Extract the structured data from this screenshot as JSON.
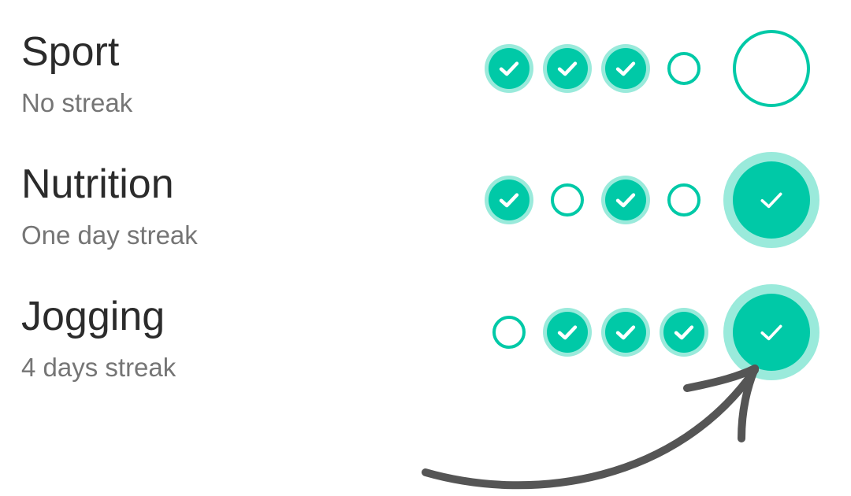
{
  "accent_color": "#00c9a7",
  "accent_halo_color": "#9aeadb",
  "arrow_color": "#555555",
  "habits": [
    {
      "name": "Sport",
      "streak": "No streak",
      "days": [
        true,
        true,
        true,
        false
      ],
      "today": false
    },
    {
      "name": "Nutrition",
      "streak": "One day streak",
      "days": [
        true,
        false,
        true,
        false
      ],
      "today": true
    },
    {
      "name": "Jogging",
      "streak": "4 days streak",
      "days": [
        false,
        true,
        true,
        true
      ],
      "today": true
    }
  ],
  "icons": {
    "done": "checkmark-icon",
    "annotation": "curved-arrow-icon"
  }
}
